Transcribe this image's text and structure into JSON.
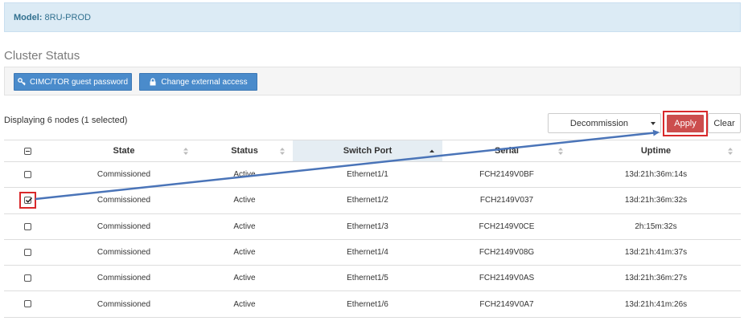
{
  "model": {
    "label": "Model:",
    "value": "8RU-PROD"
  },
  "section_title": "Cluster Status",
  "toolbar": {
    "cimc_button": "CIMC/TOR guest password",
    "external_button": "Change external access"
  },
  "display_count": "Displaying 6 nodes (1 selected)",
  "action": {
    "selected": "Decommission",
    "apply": "Apply",
    "clear": "Clear"
  },
  "table": {
    "headers": {
      "state": "State",
      "status": "Status",
      "switch_port": "Switch Port",
      "serial": "Serial",
      "uptime": "Uptime"
    },
    "sorted_column": "switch_port",
    "rows": [
      {
        "selected": false,
        "state": "Commissioned",
        "status": "Active",
        "switch_port": "Ethernet1/1",
        "serial": "FCH2149V0BF",
        "uptime": "13d:21h:36m:14s"
      },
      {
        "selected": true,
        "state": "Commissioned",
        "status": "Active",
        "switch_port": "Ethernet1/2",
        "serial": "FCH2149V037",
        "uptime": "13d:21h:36m:32s"
      },
      {
        "selected": false,
        "state": "Commissioned",
        "status": "Active",
        "switch_port": "Ethernet1/3",
        "serial": "FCH2149V0CE",
        "uptime": "2h:15m:32s"
      },
      {
        "selected": false,
        "state": "Commissioned",
        "status": "Active",
        "switch_port": "Ethernet1/4",
        "serial": "FCH2149V08G",
        "uptime": "13d:21h:41m:37s"
      },
      {
        "selected": false,
        "state": "Commissioned",
        "status": "Active",
        "switch_port": "Ethernet1/5",
        "serial": "FCH2149V0AS",
        "uptime": "13d:21h:36m:27s"
      },
      {
        "selected": false,
        "state": "Commissioned",
        "status": "Active",
        "switch_port": "Ethernet1/6",
        "serial": "FCH2149V0A7",
        "uptime": "13d:21h:41m:26s"
      }
    ]
  },
  "colors": {
    "accent": "#4a8bcb",
    "apply": "#cc4d4d",
    "highlight": "#d9292b",
    "arrow": "#4a74b8",
    "info_bg": "#dcebf5"
  }
}
